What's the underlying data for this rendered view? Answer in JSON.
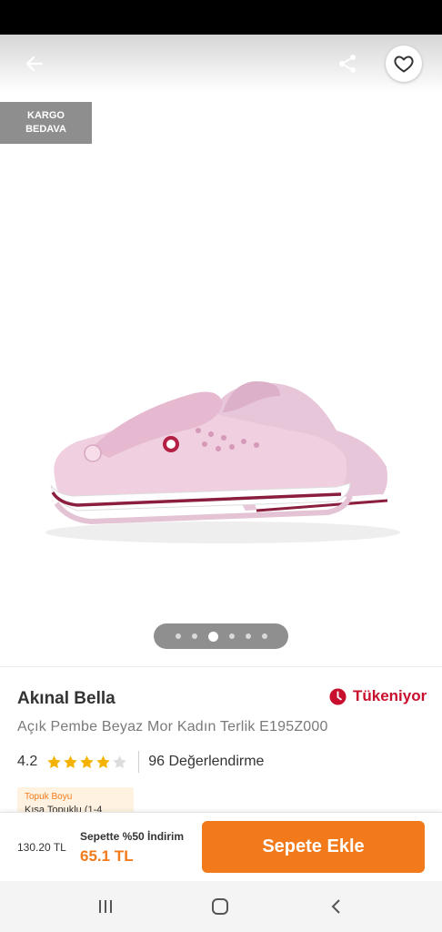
{
  "header": {
    "back_icon": "arrow-left-icon",
    "share_icon": "share-icon",
    "favorite_icon": "heart-outline-icon"
  },
  "badge": {
    "line1": "KARGO",
    "line2": "BEDAVA"
  },
  "gallery": {
    "image_count": 6,
    "active_index": 2
  },
  "product": {
    "brand": "Akınal Bella",
    "stock_status": "Tükeniyor",
    "stock_icon": "clock-icon",
    "title": "Açık Pembe Beyaz Mor Kadın Terlik E195Z000",
    "rating": "4.2",
    "rating_value": 4.2,
    "rating_max": 5,
    "review_count": "96 Değerlendirme"
  },
  "attribute": {
    "label": "Topuk Boyu",
    "value": "Kısa Topuklu (1-4"
  },
  "purchase": {
    "old_price": "130.20 TL",
    "discount_text": "Sepette %50 İndirim",
    "new_price": "65.1 TL",
    "add_to_cart_label": "Sepete Ekle"
  },
  "colors": {
    "accent": "#f27a1a",
    "stock_red": "#c8102e",
    "star": "#f5b301",
    "badge_bg": "#8e8e8e"
  },
  "system_nav": {
    "recents_icon": "recents-icon",
    "home_icon": "home-icon",
    "back_icon": "back-chevron-icon"
  }
}
